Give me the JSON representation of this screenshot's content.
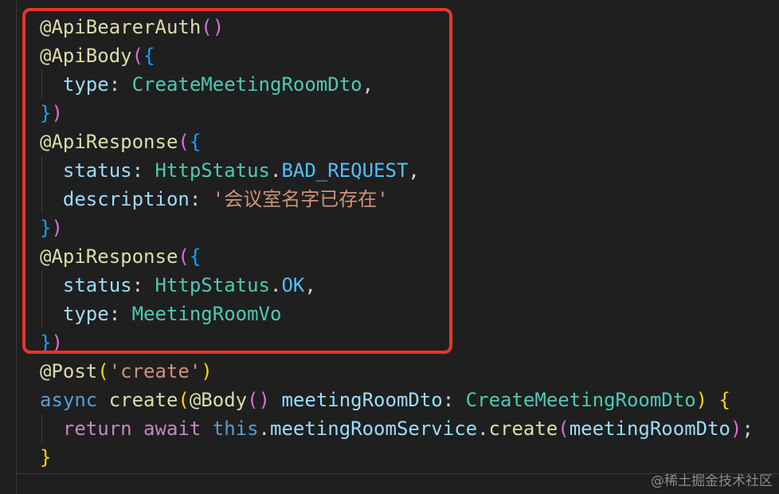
{
  "editor": {
    "lines": [
      [
        {
          "t": "@ApiBearerAuth",
          "c": "dec"
        },
        {
          "t": "()",
          "c": "br1"
        }
      ],
      [
        {
          "t": "@ApiBody",
          "c": "dec"
        },
        {
          "t": "(",
          "c": "br1"
        },
        {
          "t": "{",
          "c": "br2"
        }
      ],
      [
        {
          "t": "  type",
          "c": "prop"
        },
        {
          "t": ": ",
          "c": "plain"
        },
        {
          "t": "CreateMeetingRoomDto",
          "c": "type"
        },
        {
          "t": ",",
          "c": "plain"
        }
      ],
      [
        {
          "t": "}",
          "c": "br2"
        },
        {
          "t": ")",
          "c": "br1"
        }
      ],
      [
        {
          "t": "@ApiResponse",
          "c": "dec"
        },
        {
          "t": "(",
          "c": "br1"
        },
        {
          "t": "{",
          "c": "br2"
        }
      ],
      [
        {
          "t": "  status",
          "c": "prop"
        },
        {
          "t": ": ",
          "c": "plain"
        },
        {
          "t": "HttpStatus",
          "c": "type"
        },
        {
          "t": ".",
          "c": "plain"
        },
        {
          "t": "BAD_REQUEST",
          "c": "const"
        },
        {
          "t": ",",
          "c": "plain"
        }
      ],
      [
        {
          "t": "  description",
          "c": "prop"
        },
        {
          "t": ": ",
          "c": "plain"
        },
        {
          "t": "'会议室名字已存在'",
          "c": "str"
        }
      ],
      [
        {
          "t": "}",
          "c": "br2"
        },
        {
          "t": ")",
          "c": "br1"
        }
      ],
      [
        {
          "t": "@ApiResponse",
          "c": "dec"
        },
        {
          "t": "(",
          "c": "br1"
        },
        {
          "t": "{",
          "c": "br2"
        }
      ],
      [
        {
          "t": "  status",
          "c": "prop"
        },
        {
          "t": ": ",
          "c": "plain"
        },
        {
          "t": "HttpStatus",
          "c": "type"
        },
        {
          "t": ".",
          "c": "plain"
        },
        {
          "t": "OK",
          "c": "const"
        },
        {
          "t": ",",
          "c": "plain"
        }
      ],
      [
        {
          "t": "  type",
          "c": "prop"
        },
        {
          "t": ": ",
          "c": "plain"
        },
        {
          "t": "MeetingRoomVo",
          "c": "type"
        }
      ],
      [
        {
          "t": "}",
          "c": "br2"
        },
        {
          "t": ")",
          "c": "br1"
        }
      ],
      [
        {
          "t": "@Post",
          "c": "dec"
        },
        {
          "t": "(",
          "c": "br3"
        },
        {
          "t": "'create'",
          "c": "str"
        },
        {
          "t": ")",
          "c": "br3"
        }
      ],
      [
        {
          "t": "async ",
          "c": "kw"
        },
        {
          "t": "create",
          "c": "fn"
        },
        {
          "t": "(",
          "c": "br3"
        },
        {
          "t": "@Body",
          "c": "dec"
        },
        {
          "t": "()",
          "c": "br1"
        },
        {
          "t": " meetingRoomDto",
          "c": "prop"
        },
        {
          "t": ": ",
          "c": "plain"
        },
        {
          "t": "CreateMeetingRoomDto",
          "c": "type"
        },
        {
          "t": ")",
          "c": "br3"
        },
        {
          "t": " {",
          "c": "br3"
        }
      ],
      [
        {
          "t": "  return ",
          "c": "ctrl"
        },
        {
          "t": "await ",
          "c": "ctrl"
        },
        {
          "t": "this",
          "c": "kw"
        },
        {
          "t": ".",
          "c": "plain"
        },
        {
          "t": "meetingRoomService",
          "c": "prop"
        },
        {
          "t": ".",
          "c": "plain"
        },
        {
          "t": "create",
          "c": "fn"
        },
        {
          "t": "(",
          "c": "br1"
        },
        {
          "t": "meetingRoomDto",
          "c": "prop"
        },
        {
          "t": ")",
          "c": "br1"
        },
        {
          "t": ";",
          "c": "plain"
        }
      ],
      [
        {
          "t": "}",
          "c": "br3"
        }
      ]
    ]
  },
  "watermark": "@稀土掘金技术社区",
  "colors": {
    "background": "#1f1f1f",
    "highlight_border": "#e8352b",
    "decorator": "#dcdcaa",
    "type": "#4ec9b0",
    "property": "#9cdcfe",
    "string": "#ce9178"
  }
}
